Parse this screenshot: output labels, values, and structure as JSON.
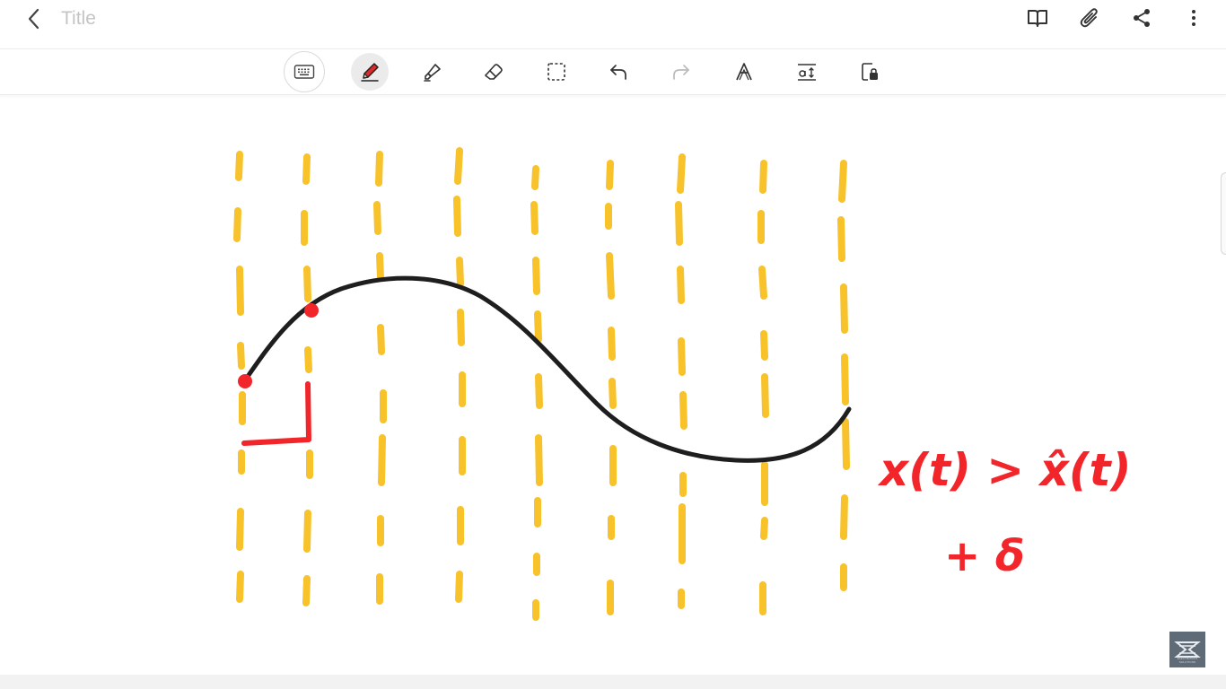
{
  "header": {
    "title": "Title",
    "icons": {
      "back": "chevron-left-icon",
      "reading_mode": "book-open-icon",
      "attach": "paperclip-icon",
      "share": "share-icon",
      "more": "more-vertical-icon"
    }
  },
  "toolbar": {
    "tools": [
      "keyboard-icon",
      "pen-icon",
      "highlighter-icon",
      "eraser-icon",
      "lasso-select-icon",
      "undo-icon",
      "redo-icon",
      "text-style-icon",
      "text-size-icon",
      "lock-icon"
    ],
    "active_tool": "pen",
    "accent_color": "#e02828"
  },
  "canvas": {
    "ink_colors": {
      "yellow": "#f7c22a",
      "black": "#1e1e1e",
      "red": "#f2262a"
    },
    "handwriting": {
      "line1": "x(t) > x̂(t)",
      "line2": "+ δ"
    }
  },
  "logo": {
    "text": "ELECTRONICS SOLUTIONS"
  }
}
